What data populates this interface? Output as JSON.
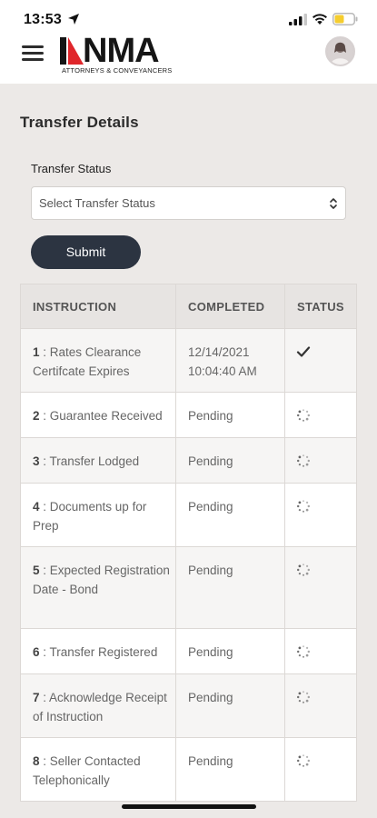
{
  "status_bar": {
    "time": "13:53"
  },
  "header": {
    "logo_word": "NMA",
    "logo_tagline": "ATTORNEYS & CONVEYANCERS",
    "brand_red": "#e0262b"
  },
  "page": {
    "title": "Transfer Details"
  },
  "form": {
    "status_label": "Transfer Status",
    "status_select": "Select Transfer Status",
    "submit_label": "Submit"
  },
  "table": {
    "headers": {
      "instruction": "INSTRUCTION",
      "completed": "COMPLETED",
      "status": "STATUS"
    },
    "rows": [
      {
        "num": "1",
        "text": " : Rates Clearance Certifcate Expires",
        "completed": "12/14/2021 10:04:40 AM",
        "status": "check-icon"
      },
      {
        "num": "2",
        "text": " : Guarantee Received",
        "completed": "Pending",
        "status": "spinner-icon"
      },
      {
        "num": "3",
        "text": " : Transfer Lodged",
        "completed": "Pending",
        "status": "spinner-icon"
      },
      {
        "num": "4",
        "text": " : Documents up for Prep",
        "completed": "Pending",
        "status": "spinner-icon"
      },
      {
        "num": "5",
        "text": " : Expected Registration Date - Bond",
        "completed": "Pending",
        "status": "spinner-icon"
      },
      {
        "num": "6",
        "text": " : Transfer Registered",
        "completed": "Pending",
        "status": "spinner-icon"
      },
      {
        "num": "7",
        "text": " : Acknowledge Receipt of Instruction",
        "completed": "Pending",
        "status": "spinner-icon"
      },
      {
        "num": "8",
        "text": " : Seller Contacted Telephonically",
        "completed": "Pending",
        "status": "spinner-icon"
      }
    ]
  },
  "colors": {
    "button": "#2c3441",
    "background": "#ece9e7"
  }
}
